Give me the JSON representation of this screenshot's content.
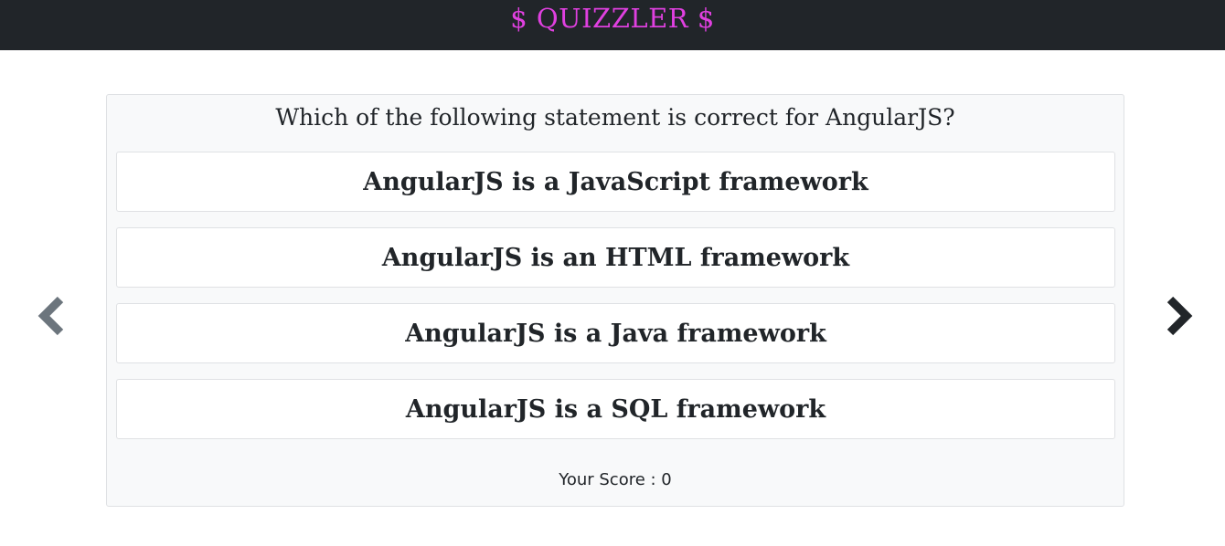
{
  "header": {
    "title": "$ QUIZZLER $",
    "title_color": "#e040e0",
    "background": "#212529"
  },
  "quiz": {
    "question": "Which of the following statement is correct for AngularJS?",
    "options": [
      "AngularJS is a JavaScript framework",
      "AngularJS is an HTML framework",
      "AngularJS is a Java framework",
      "AngularJS is a SQL framework"
    ],
    "score_label": "Your Score : 0"
  },
  "navigation": {
    "prev_icon": "chevron-left-icon",
    "next_icon": "chevron-right-icon"
  }
}
